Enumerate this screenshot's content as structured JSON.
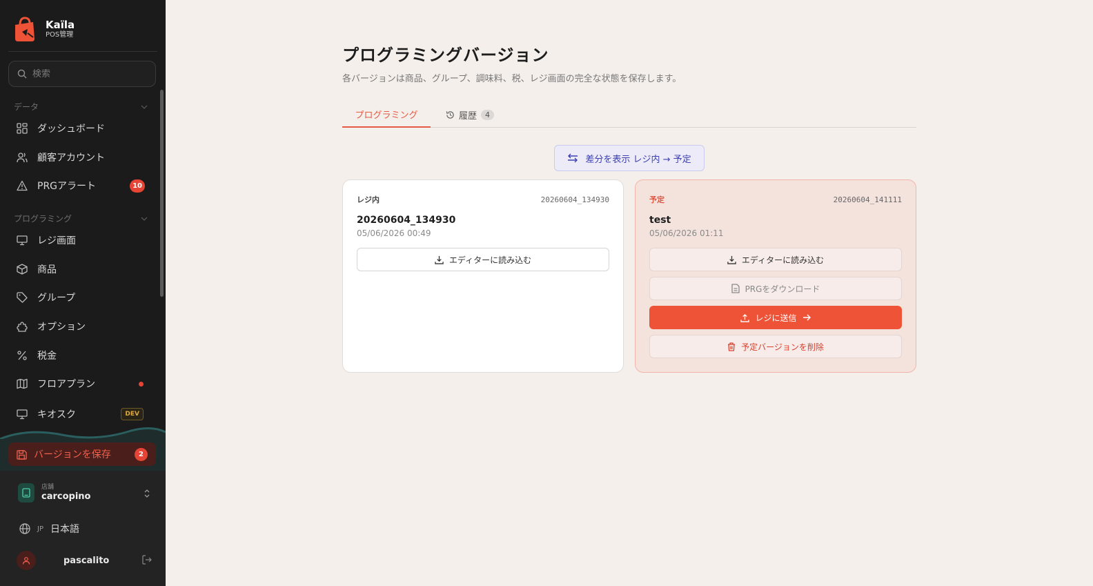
{
  "brand": {
    "name": "Kaïla",
    "subtitle": "POS管理"
  },
  "search": {
    "placeholder": "検索"
  },
  "sidebar": {
    "section_data": "データ",
    "section_programming": "プログラミング",
    "items": [
      {
        "label": "ダッシュボード",
        "icon": "dashboard-icon"
      },
      {
        "label": "顧客アカウント",
        "icon": "users-icon"
      },
      {
        "label": "PRGアラート",
        "icon": "alert-icon",
        "badge": "10"
      },
      {
        "label": "レジ画面",
        "icon": "monitor-icon"
      },
      {
        "label": "商品",
        "icon": "box-icon"
      },
      {
        "label": "グループ",
        "icon": "tag-icon"
      },
      {
        "label": "オプション",
        "icon": "puzzle-icon"
      },
      {
        "label": "税金",
        "icon": "percent-icon"
      },
      {
        "label": "フロアプラン",
        "icon": "map-icon"
      },
      {
        "label": "キオスク",
        "icon": "monitor-icon",
        "tag": "DEV"
      }
    ],
    "save": {
      "label": "バージョンを保存",
      "badge": "2"
    },
    "store": {
      "label": "店舗",
      "name": "carcopino"
    },
    "language": {
      "code": "JP",
      "label": "日本語"
    },
    "user": {
      "name": "pascalito"
    }
  },
  "main": {
    "title": "プログラミングバージョン",
    "subtitle": "各バージョンは商品、グループ、調味料、税、レジ画面の完全な状態を保存します。",
    "tabs": [
      {
        "label": "プログラミング",
        "active": true
      },
      {
        "label": "履歴",
        "count": "4"
      }
    ],
    "diff_button": "差分を表示 レジ内 → 予定",
    "cards": {
      "current": {
        "label": "レジ内",
        "id": "20260604_134930",
        "name": "20260604_134930",
        "date": "05/06/2026 00:49",
        "load_button": "エディターに読み込む"
      },
      "planned": {
        "label": "予定",
        "id": "20260604_141111",
        "name": "test",
        "date": "05/06/2026 01:11",
        "load_button": "エディターに読み込む",
        "download_button": "PRGをダウンロード",
        "send_button": "レジに送信",
        "delete_button": "予定バージョンを削除"
      }
    }
  },
  "colors": {
    "accent": "#ef5337",
    "sidebar_bg": "#1b1b1b",
    "page_bg": "#f5efeb"
  }
}
